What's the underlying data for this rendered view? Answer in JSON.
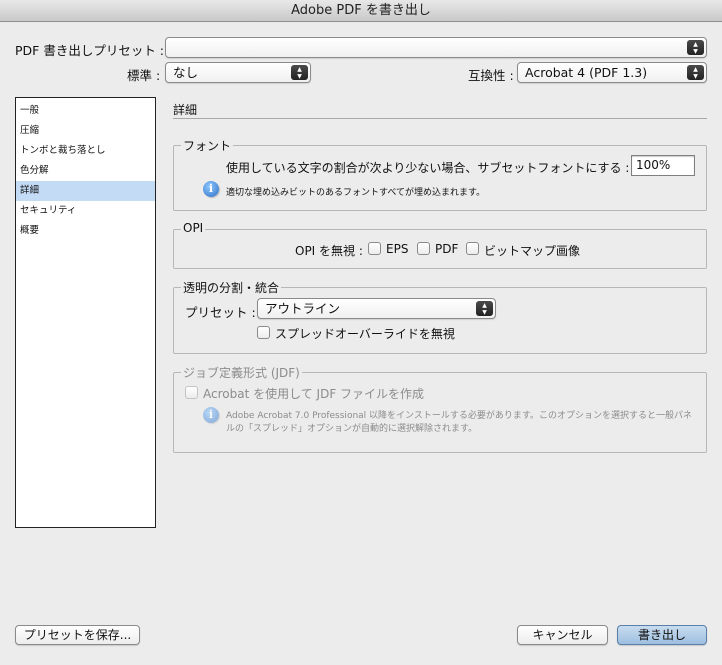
{
  "window": {
    "title": "Adobe PDF を書き出し"
  },
  "top": {
    "preset_label": "PDF 書き出しプリセット :",
    "preset_value": "",
    "standard_label": "標準 :",
    "standard_value": "なし",
    "compat_label": "互換性 :",
    "compat_value": "Acrobat 4 (PDF 1.3)"
  },
  "sidebar": {
    "items": [
      {
        "label": "一般"
      },
      {
        "label": "圧縮"
      },
      {
        "label": "トンボと裁ち落とし"
      },
      {
        "label": "色分解"
      },
      {
        "label": "詳細",
        "selected": true
      },
      {
        "label": "セキュリティ"
      },
      {
        "label": "概要"
      }
    ]
  },
  "section": {
    "title": "詳細"
  },
  "fonts": {
    "group_label": "フォント",
    "subset_label": "使用している文字の割合が次より少ない場合、サブセットフォントにする :",
    "subset_value": "100%",
    "info_text": "適切な埋め込みビットのあるフォントすべてが埋め込まれます。"
  },
  "opi": {
    "group_label": "OPI",
    "ignore_label": "OPI を無視 :",
    "eps_label": "EPS",
    "pdf_label": "PDF",
    "bitmap_label": "ビットマップ画像"
  },
  "transparency": {
    "group_label": "透明の分割・統合",
    "preset_label": "プリセット :",
    "preset_value": "アウトライン",
    "ignore_spread_label": "スプレッドオーバーライドを無視"
  },
  "jdf": {
    "group_label": "ジョブ定義形式 (JDF)",
    "create_label": "Acrobat を使用して JDF ファイルを作成",
    "info_line1": "Adobe Acrobat 7.0 Professional 以降をインストールする必要があります。このオプションを選択すると一般パネ",
    "info_line2": "ルの「スプレッド」オプションが自動的に選択解除されます。"
  },
  "buttons": {
    "save_preset": "プリセットを保存...",
    "cancel": "キャンセル",
    "export": "書き出し"
  }
}
